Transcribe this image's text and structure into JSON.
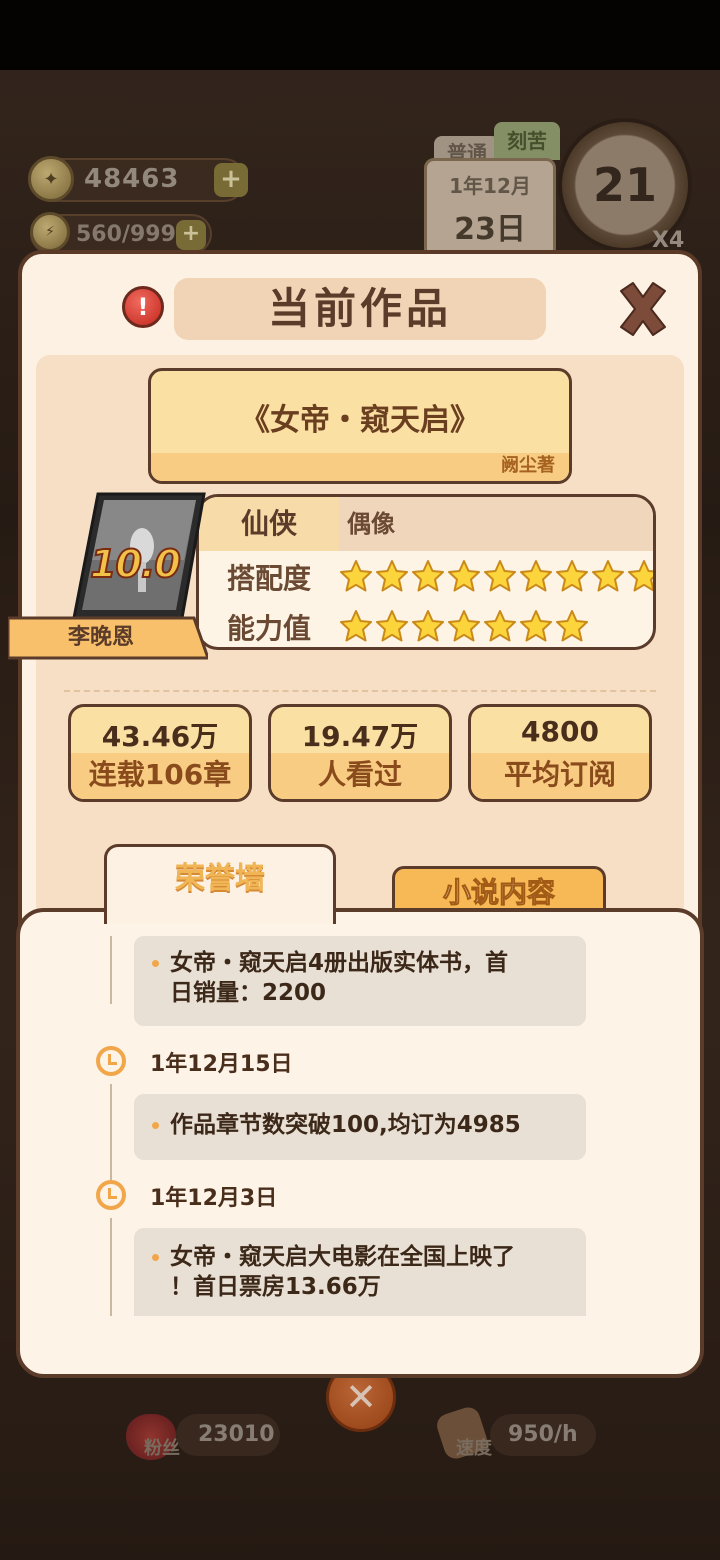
{
  "hud": {
    "coins": "48463",
    "energy": "560/999",
    "tag_normal": "普通",
    "tag_hard": "刻苦",
    "date_line1": "1年12月",
    "date_line2": "23日",
    "clock_value": "21",
    "multiplier": "X4",
    "fans_label": "粉丝",
    "fans_value": "23010",
    "speed_label": "速度",
    "speed_value": "950/h"
  },
  "dialog": {
    "title": "当前作品",
    "work_title": "《女帝・窥天启》",
    "author": "阙尘著",
    "rating": "10.0",
    "protagonist": "李晚恩",
    "genre": "仙侠",
    "tag": "偶像",
    "match_label": "搭配度",
    "match_stars": 9,
    "ability_label": "能力值",
    "ability_stars": 7,
    "metrics": [
      {
        "top": "43.46万",
        "bottom": "连载106章"
      },
      {
        "top": "19.47万",
        "bottom": "人看过"
      },
      {
        "top": "4800",
        "bottom": "平均订阅"
      }
    ],
    "tabs": {
      "honor": "荣誉墙",
      "content": "小说内容"
    },
    "timeline": [
      {
        "date": "",
        "lines": [
          "女帝・窥天启4册出版实体书，首",
          "日销量：2200"
        ]
      },
      {
        "date": "1年12月15日",
        "lines": [
          "作品章节数突破100,均订为4985"
        ]
      },
      {
        "date": "1年12月3日",
        "lines": [
          "女帝・窥天启大电影在全国上映了",
          "！首日票房13.66万"
        ]
      }
    ]
  },
  "colors": {
    "panel_bg": "#fdf1e3",
    "border": "#5b3b29",
    "accent": "#f1a64a",
    "card_yellow": "#fbe0a3"
  }
}
